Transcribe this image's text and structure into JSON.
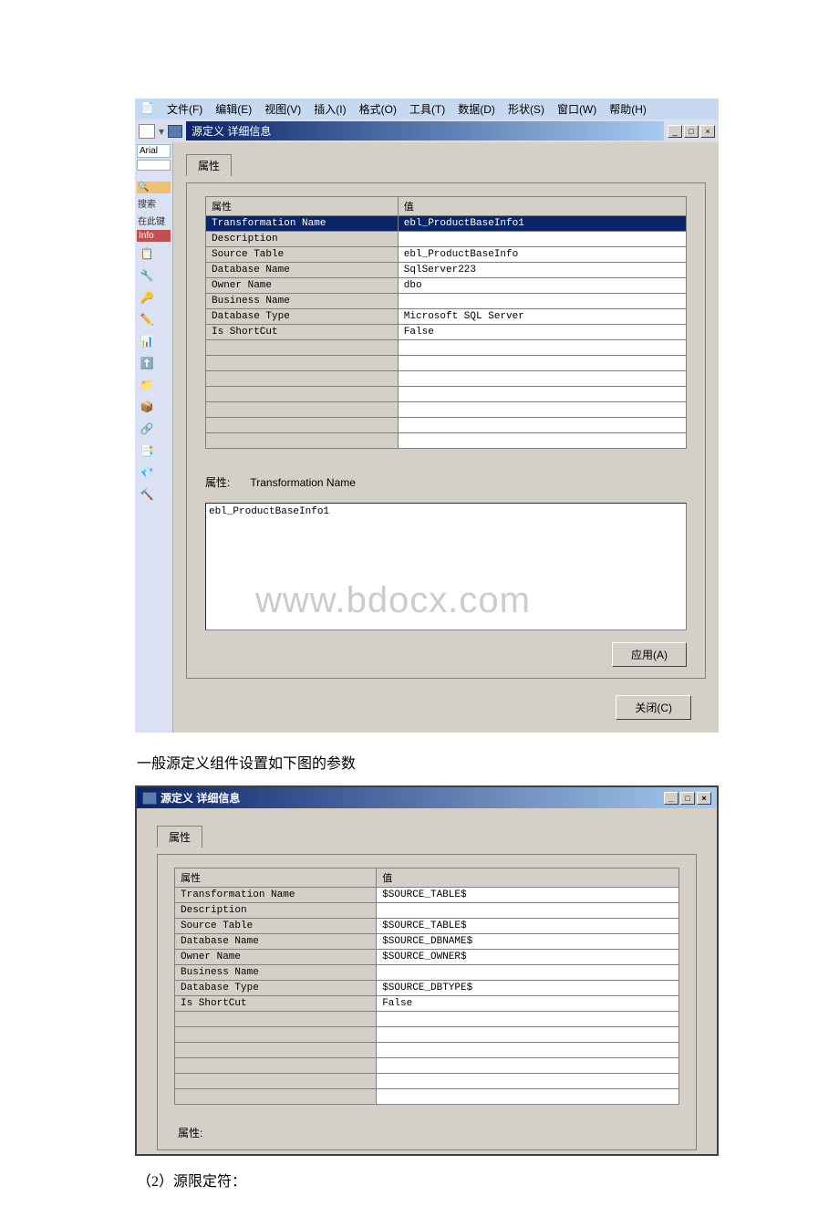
{
  "menubar": {
    "items": [
      "文件(F)",
      "编辑(E)",
      "视图(V)",
      "插入(I)",
      "格式(O)",
      "工具(T)",
      "数据(D)",
      "形状(S)",
      "窗口(W)",
      "帮助(H)"
    ]
  },
  "sidebar": {
    "font": "Arial",
    "search": "搜索",
    "here": "在此键",
    "info": "Info"
  },
  "dialog1": {
    "title": "源定义 详细信息",
    "tab": "属性",
    "headers": [
      "属性",
      "值"
    ],
    "rows": [
      {
        "attr": "Transformation Name",
        "val": "ebl_ProductBaseInfo1"
      },
      {
        "attr": "Description",
        "val": ""
      },
      {
        "attr": "Source Table",
        "val": "ebl_ProductBaseInfo"
      },
      {
        "attr": "Database Name",
        "val": "SqlServer223"
      },
      {
        "attr": "Owner Name",
        "val": "dbo"
      },
      {
        "attr": "Business Name",
        "val": ""
      },
      {
        "attr": "Database Type",
        "val": "Microsoft SQL Server"
      },
      {
        "attr": "Is ShortCut",
        "val": "False"
      }
    ],
    "prop_label": "属性:",
    "prop_name": "Transformation Name",
    "edit_value": "ebl_ProductBaseInfo1",
    "apply": "应用(A)",
    "close": "关闭(C)"
  },
  "caption1": "一般源定义组件设置如下图的参数",
  "dialog2": {
    "title": "源定义 详细信息",
    "tab": "属性",
    "headers": [
      "属性",
      "值"
    ],
    "rows": [
      {
        "attr": "Transformation Name",
        "val": "$SOURCE_TABLE$"
      },
      {
        "attr": "Description",
        "val": ""
      },
      {
        "attr": "Source Table",
        "val": "$SOURCE_TABLE$"
      },
      {
        "attr": "Database Name",
        "val": "$SOURCE_DBNAME$"
      },
      {
        "attr": "Owner Name",
        "val": "$SOURCE_OWNER$"
      },
      {
        "attr": "Business Name",
        "val": ""
      },
      {
        "attr": "Database Type",
        "val": "$SOURCE_DBTYPE$"
      },
      {
        "attr": "Is ShortCut",
        "val": "False"
      }
    ],
    "prop_label": "属性:"
  },
  "caption2": "（2）源限定符：",
  "watermark": "www.bdocx.com"
}
